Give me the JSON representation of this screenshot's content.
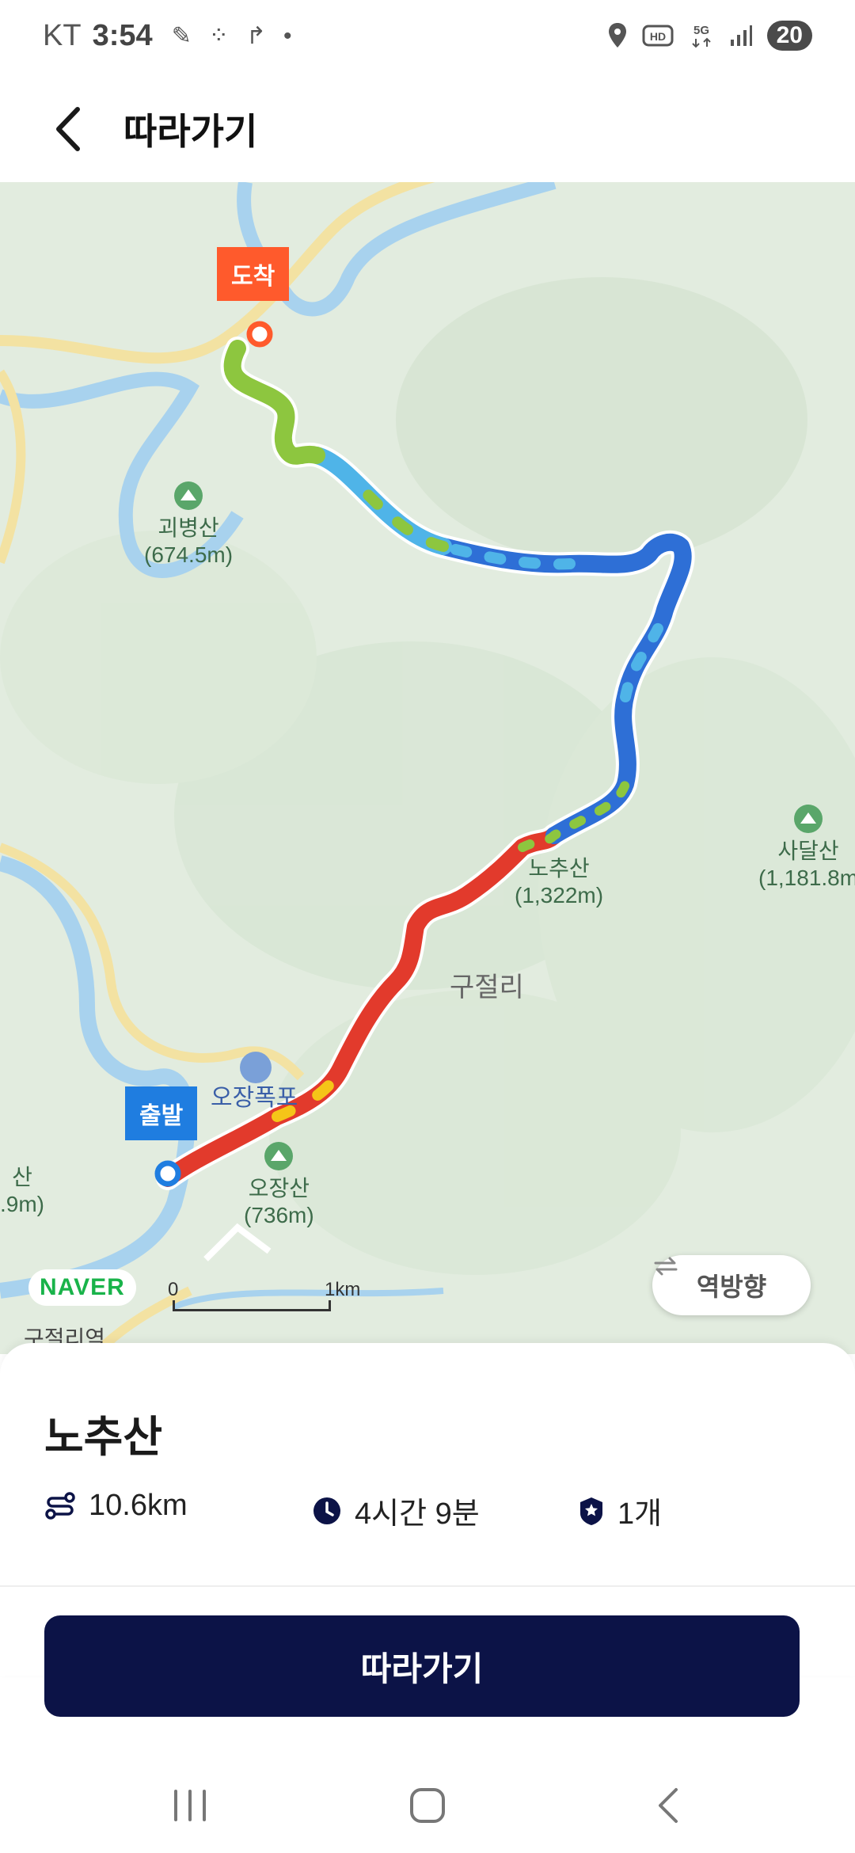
{
  "status_bar": {
    "carrier": "KT",
    "time": "3:54",
    "battery": "20",
    "left_icons": [
      "sound-tool-icon",
      "dots-grid-icon",
      "route-icon",
      "dot-icon"
    ],
    "right_icons": [
      "location-icon",
      "hd-icon",
      "5g-icon",
      "signal-icon"
    ]
  },
  "header": {
    "title": "따라가기"
  },
  "map": {
    "arrive_label": "도착",
    "depart_label": "출발",
    "reverse_label": "역방향",
    "naver_logo": "NAVER",
    "scale_start": "0",
    "scale_end": "1km",
    "labels": [
      {
        "name": "괴병산",
        "height": "(674.5m)"
      },
      {
        "name": "노추산",
        "height": "(1,322m)"
      },
      {
        "name": "사달산",
        "height": "(1,181.8m"
      },
      {
        "name": "오장산",
        "height": "(736m)"
      },
      {
        "name": "오장폭포",
        "height": ""
      },
      {
        "name": "산",
        "height": ".9m)"
      }
    ],
    "place_label": "구절리",
    "station_label": "구절리역"
  },
  "course": {
    "name": "노추산",
    "distance": "10.6km",
    "duration": "4시간 9분",
    "stamps": "1개"
  },
  "actions": {
    "follow_button": "따라가기"
  },
  "colors": {
    "primary_navy": "#0c1347",
    "arrive_orange": "#ff5a2c",
    "depart_blue": "#1f7de0",
    "route_red": "#e23a2c",
    "route_blue": "#2e6fd6",
    "route_green": "#8dc63f",
    "map_green": "#e2ecdf"
  }
}
